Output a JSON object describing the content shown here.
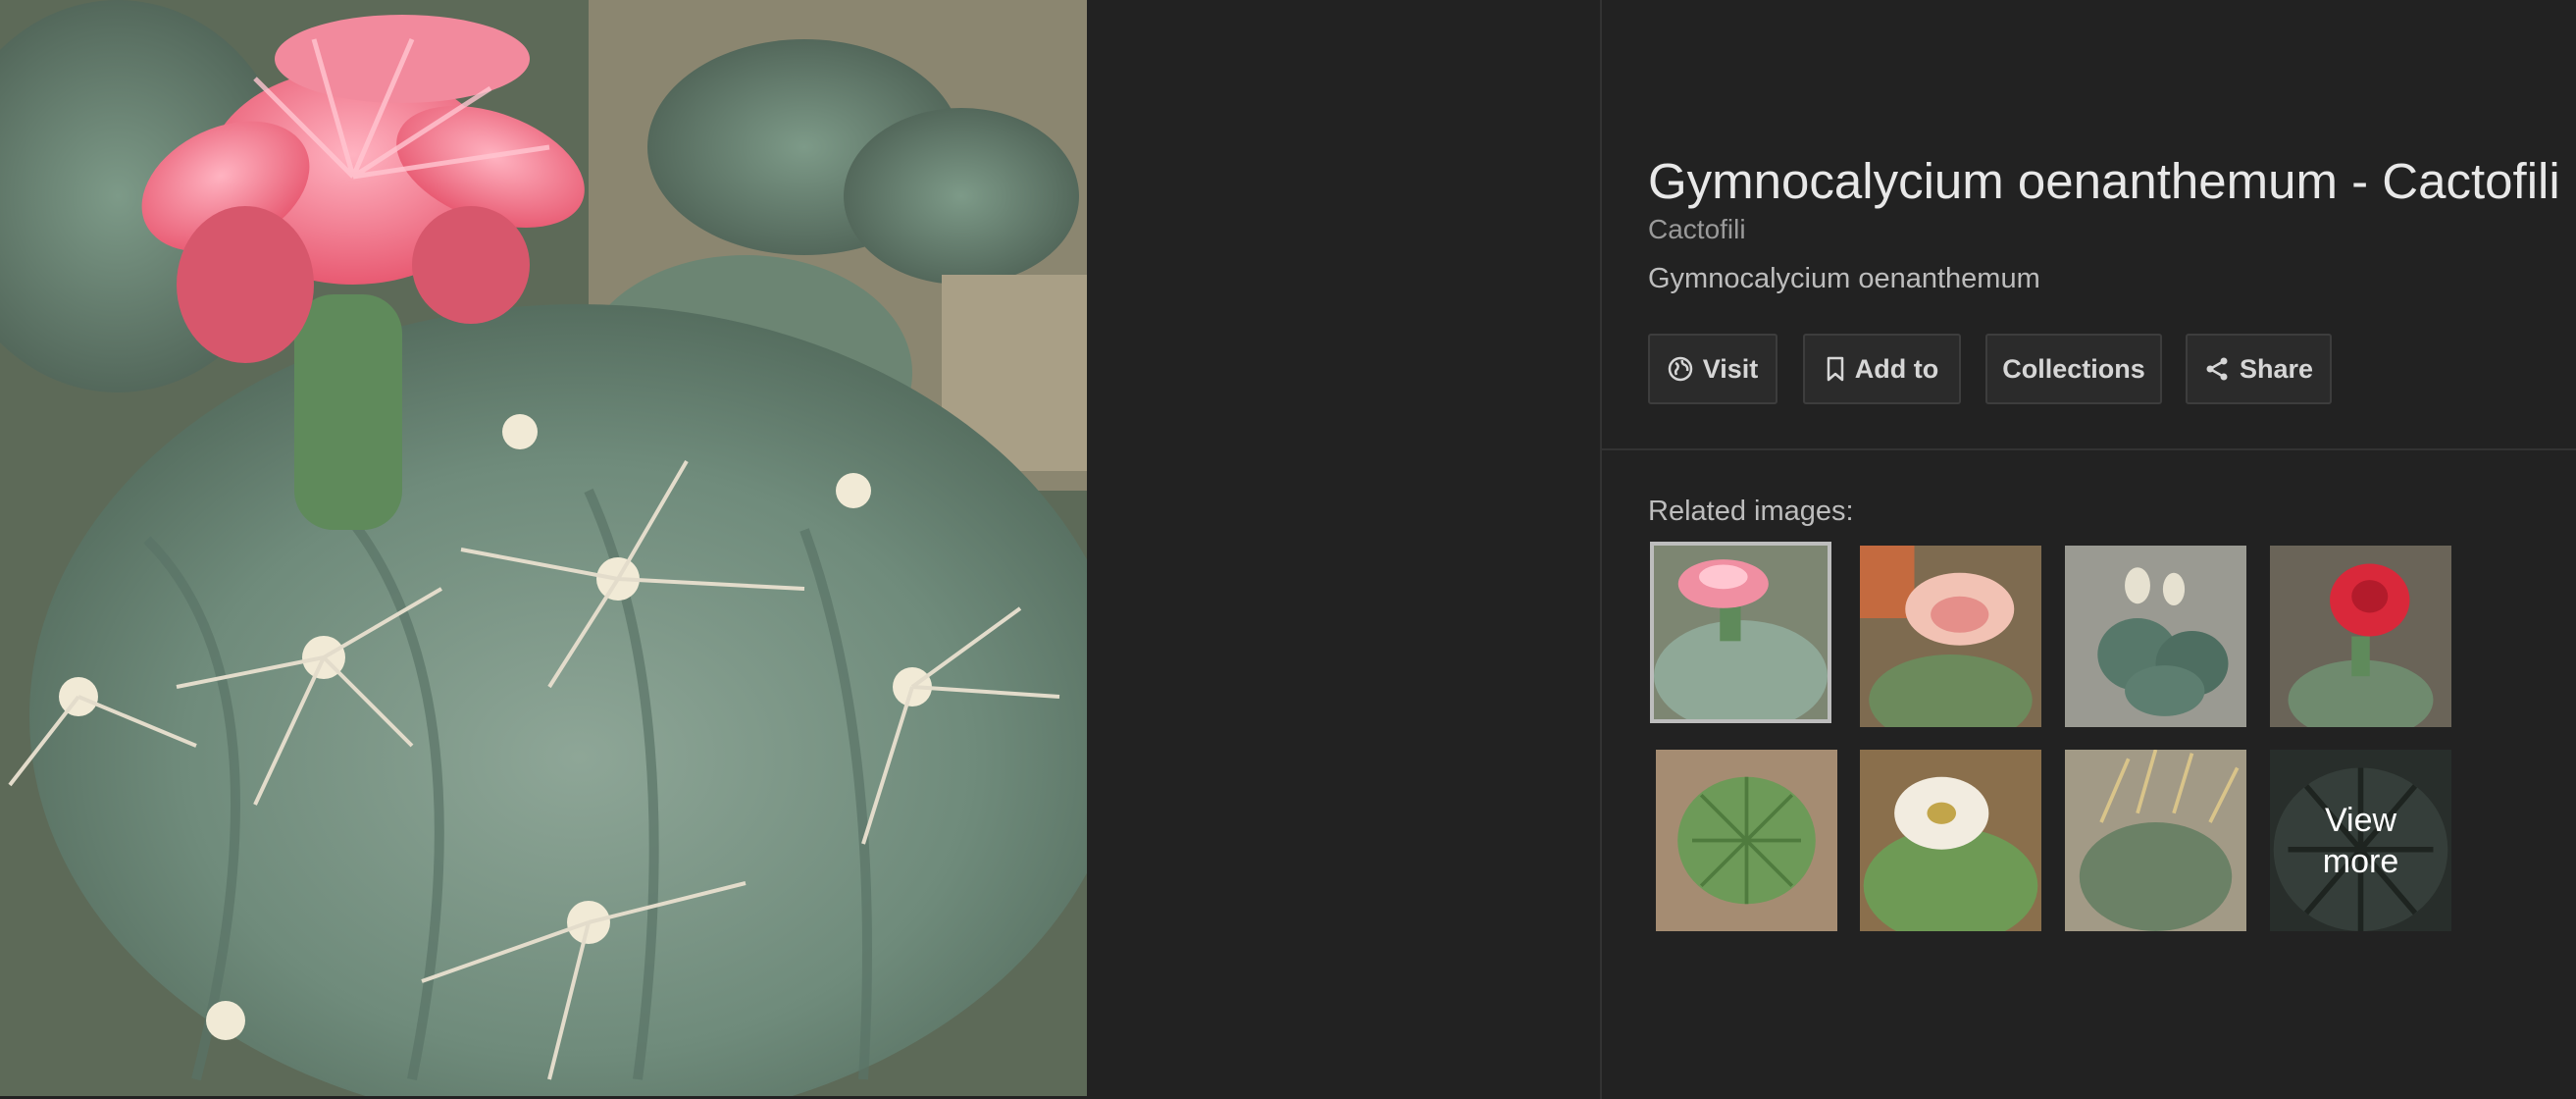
{
  "main_image": {
    "alt_icon": "cactus-flower-photo"
  },
  "details": {
    "title": "Gymnocalycium oenanthemum - Cactofili",
    "source": "Cactofili",
    "description": "Gymnocalycium oenanthemum"
  },
  "actions": {
    "visit_label": "Visit",
    "visit_icon": "globe-icon",
    "add_label": "Add to",
    "add_icon": "bookmark-icon",
    "collections_label": "Collections",
    "share_label": "Share",
    "share_icon": "share-icon"
  },
  "related": {
    "label": "Related images:",
    "view_more_label": "View more"
  },
  "colors": {
    "background": "#222222",
    "button_bg": "#2b2b2b",
    "text_primary": "#e8e8e8",
    "text_secondary": "#9a9a9a"
  }
}
